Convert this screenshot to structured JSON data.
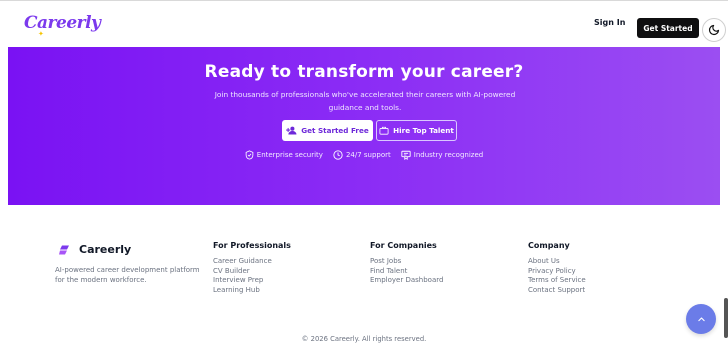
{
  "header": {
    "logo_text": "Careerly",
    "sign_in": "Sign In",
    "get_started": "Get Started"
  },
  "hero": {
    "title": "Ready to transform your career?",
    "subtitle": "Join thousands of professionals who've accelerated their careers with AI-powered guidance and tools.",
    "primary_button": "Get Started Free",
    "secondary_button": "Hire Top Talent",
    "badges": [
      {
        "icon": "shield-check-icon",
        "label": "Enterprise security"
      },
      {
        "icon": "clock-icon",
        "label": "24/7 support"
      },
      {
        "icon": "award-icon",
        "label": "Industry recognized"
      }
    ]
  },
  "footer": {
    "brand_name": "Careerly",
    "brand_description": "AI-powered career development platform for the modern workforce.",
    "columns": [
      {
        "title": "For Professionals",
        "links": [
          "Career Guidance",
          "CV Builder",
          "Interview Prep",
          "Learning Hub"
        ]
      },
      {
        "title": "For Companies",
        "links": [
          "Post Jobs",
          "Find Talent",
          "Employer Dashboard"
        ]
      },
      {
        "title": "Company",
        "links": [
          "About Us",
          "Privacy Policy",
          "Terms of Service",
          "Contact Support"
        ]
      }
    ],
    "copyright": "© 2026 Careerly. All rights reserved."
  },
  "colors": {
    "accent": "#7c3aed",
    "hero_start": "#7a12f3",
    "hero_end": "#9b4ef2",
    "scroll_button": "#6b7ce8"
  }
}
